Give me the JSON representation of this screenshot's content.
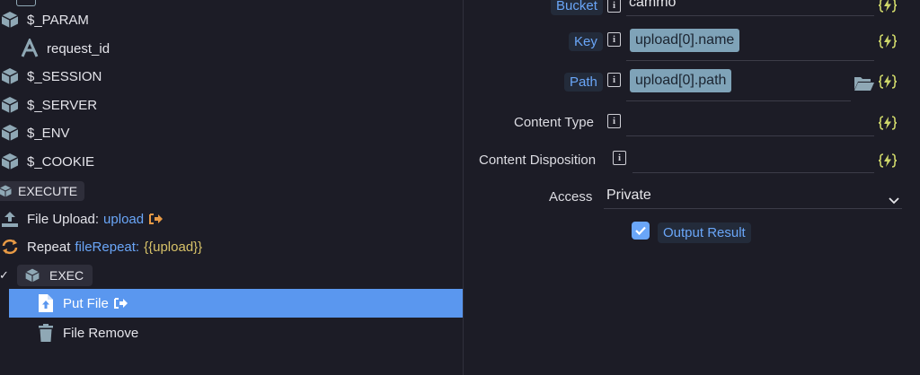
{
  "tree": {
    "param": "$_PARAM",
    "request_id": "request_id",
    "session": "$_SESSION",
    "server": "$_SERVER",
    "env": "$_ENV",
    "cookie": "$_COOKIE",
    "execute": "EXECUTE",
    "file_upload_label": "File Upload:",
    "file_upload_name": "upload",
    "repeat_label": "Repeat",
    "repeat_name": "fileRepeat:",
    "repeat_expr": "{{upload}}",
    "exec_check": "✓",
    "exec": "EXEC",
    "put_file": "Put File",
    "file_remove": "File Remove"
  },
  "props": {
    "bucket_label": "Bucket",
    "bucket_value": "cammo",
    "key_label": "Key",
    "key_value": "upload[0].name",
    "path_label": "Path",
    "path_value": "upload[0].path",
    "content_type_label": "Content Type",
    "content_type_value": "",
    "content_disposition_label": "Content Disposition",
    "content_disposition_value": "",
    "access_label": "Access",
    "access_value": "Private",
    "output_result_label": "Output Result",
    "output_result_checked": true,
    "info_glyph": "i"
  },
  "colors": {
    "background": "#1c1c26",
    "accent": "#6aa6f8",
    "selected_row": "#5a97ef",
    "cube_icon": "#8fa8b5",
    "flash_icon": "#cfd86a",
    "exit_icon": "#e89a45"
  },
  "icons": {
    "cube": "cube-icon",
    "text": "text-type-icon",
    "upload": "upload-icon",
    "repeat": "repeat-icon",
    "file_put": "file-upload-icon",
    "trash": "trash-icon",
    "exit": "exit-icon",
    "info": "info-icon",
    "flash": "dynamic-value-icon",
    "folder": "folder-open-icon",
    "chevron": "chevron-down-icon",
    "check": "check-icon"
  }
}
